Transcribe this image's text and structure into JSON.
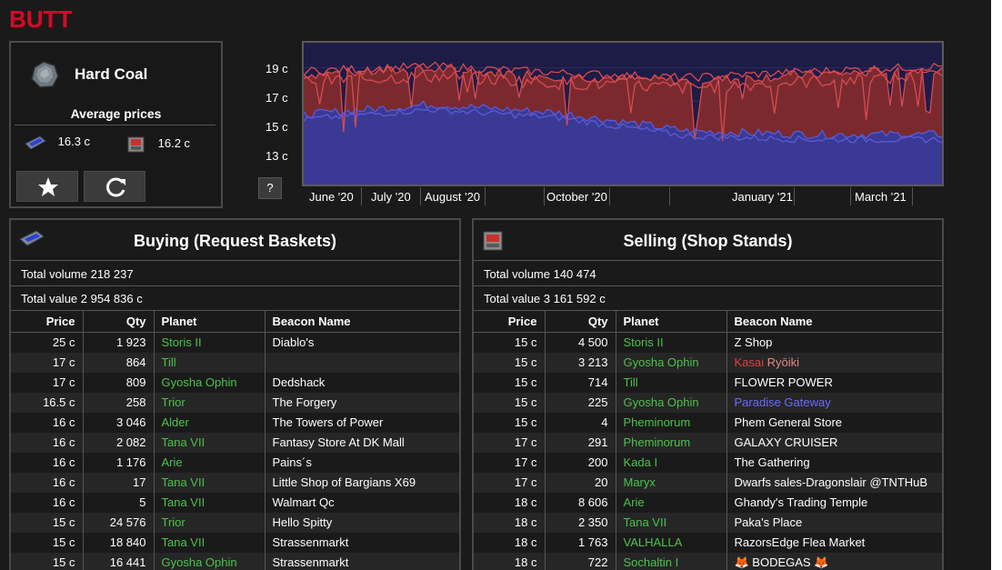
{
  "app": {
    "logo": "BUTT"
  },
  "item": {
    "name": "Hard Coal",
    "icon": "coal-ore-icon",
    "average_prices_title": "Average prices",
    "avg_buy": "16.3 c",
    "avg_sell": "16.2 c",
    "favorite_icon": "star-icon",
    "refresh_icon": "refresh-icon"
  },
  "chart": {
    "help_label": "?",
    "y_ticks": [
      "19 c",
      "17 c",
      "15 c",
      "13 c"
    ],
    "x_ticks": [
      "June '20",
      "July '20",
      "August '20",
      "October '20",
      "January '21",
      "March '21"
    ],
    "colors": {
      "sell_fill": "#7a2a2e",
      "sell_line": "#d94a52",
      "buy_fill": "#3a3a94",
      "buy_line": "#5a5ad8",
      "background": "#1c1c46"
    }
  },
  "chart_data": {
    "type": "area",
    "x": [
      "June '20",
      "July '20",
      "August '20",
      "October '20",
      "January '21",
      "March '21"
    ],
    "series": [
      {
        "values": [
          18.6,
          18.9,
          18.5,
          18.2,
          18.6,
          18.9
        ]
      },
      {
        "values": [
          16.2,
          16.8,
          16.3,
          15.2,
          15.0,
          15.0
        ]
      }
    ],
    "ylim": [
      12,
      20.5
    ],
    "grid": true
  },
  "buying": {
    "title": "Buying (Request Baskets)",
    "icon": "request-basket-icon",
    "total_volume": "Total volume 218 237",
    "total_value": "Total value 2 954 836 c",
    "headers": {
      "price": "Price",
      "qty": "Qty",
      "planet": "Planet",
      "beacon": "Beacon Name"
    },
    "rows": [
      {
        "price": "25 c",
        "qty": "1 923",
        "planet": "Storis II",
        "beacon": "Diablo's"
      },
      {
        "price": "17 c",
        "qty": "864",
        "planet": "Till",
        "beacon": ""
      },
      {
        "price": "17 c",
        "qty": "809",
        "planet": "Gyosha Ophin",
        "beacon": "Dedshack"
      },
      {
        "price": "16.5 c",
        "qty": "258",
        "planet": "Trior",
        "beacon": "The Forgery"
      },
      {
        "price": "16 c",
        "qty": "3 046",
        "planet": "Alder",
        "beacon": "The Towers of Power"
      },
      {
        "price": "16 c",
        "qty": "2 082",
        "planet": "Tana VII",
        "beacon": "Fantasy Store At DK Mall"
      },
      {
        "price": "16 c",
        "qty": "1 176",
        "planet": "Arie",
        "beacon": "Pains´s"
      },
      {
        "price": "16 c",
        "qty": "17",
        "planet": "Tana VII",
        "beacon": "Little Shop of Bargians X69"
      },
      {
        "price": "16 c",
        "qty": "5",
        "planet": "Tana VII",
        "beacon": "Walmart Qc"
      },
      {
        "price": "15 c",
        "qty": "24 576",
        "planet": "Trior",
        "beacon": "Hello Spitty"
      },
      {
        "price": "15 c",
        "qty": "18 840",
        "planet": "Tana VII",
        "beacon": "Strassenmarkt"
      },
      {
        "price": "15 c",
        "qty": "16 441",
        "planet": "Gyosha Ophin",
        "beacon": "Strassenmarkt"
      }
    ]
  },
  "selling": {
    "title": "Selling (Shop Stands)",
    "icon": "shop-stand-icon",
    "total_volume": "Total volume 140 474",
    "total_value": "Total value 3 161 592 c",
    "headers": {
      "price": "Price",
      "qty": "Qty",
      "planet": "Planet",
      "beacon": "Beacon Name"
    },
    "rows": [
      {
        "price": "15 c",
        "qty": "4 500",
        "planet": "Storis II",
        "beacon": "Z Shop",
        "beacon_color": "#ffffff"
      },
      {
        "price": "15 c",
        "qty": "3 213",
        "planet": "Gyosha Ophin",
        "beacon_a": "Kasai",
        "beacon_b": " Ryōiki",
        "beacon_color": "#e04040",
        "beacon_color_b": "#e08888"
      },
      {
        "price": "15 c",
        "qty": "714",
        "planet": "Till",
        "beacon": "FLOWER POWER",
        "beacon_color": "#ffffff"
      },
      {
        "price": "15 c",
        "qty": "225",
        "planet": "Gyosha Ophin",
        "beacon": "Paradise Gateway",
        "beacon_color": "#6a6aff"
      },
      {
        "price": "15 c",
        "qty": "4",
        "planet": "Pheminorum",
        "beacon": "Phem General Store",
        "beacon_color": "#ffffff"
      },
      {
        "price": "17 c",
        "qty": "291",
        "planet": "Pheminorum",
        "beacon": "GALAXY CRUISER",
        "beacon_color": "#ffffff"
      },
      {
        "price": "17 c",
        "qty": "200",
        "planet": "Kada I",
        "beacon": "The Gathering",
        "beacon_color": "#ffffff"
      },
      {
        "price": "17 c",
        "qty": "20",
        "planet": "Maryx",
        "beacon": "Dwarfs sales-Dragonslair @TNTHuB",
        "beacon_color": "#ffffff"
      },
      {
        "price": "18 c",
        "qty": "8 606",
        "planet": "Arie",
        "beacon": "Ghandy's Trading Temple",
        "beacon_color": "#ffffff"
      },
      {
        "price": "18 c",
        "qty": "2 350",
        "planet": "Tana VII",
        "beacon": "Paka's Place",
        "beacon_color": "#ffffff"
      },
      {
        "price": "18 c",
        "qty": "1 763",
        "planet": "VALHALLA",
        "beacon": "RazorsEdge Flea Market",
        "beacon_color": "#ffffff"
      },
      {
        "price": "18 c",
        "qty": "722",
        "planet": "Sochaltin I",
        "beacon": "🦊 BODEGAS 🦊",
        "beacon_color": "#ffffff"
      }
    ]
  }
}
